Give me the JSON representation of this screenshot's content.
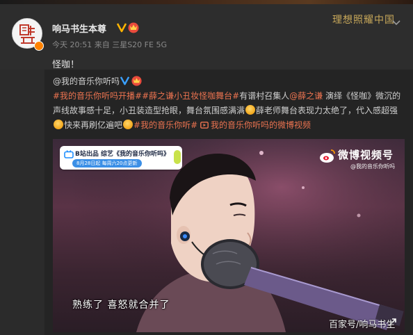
{
  "post": {
    "username": "响马书生本尊",
    "time": "今天 20:51",
    "source_prefix": "来自",
    "source": "三星S20 FE 5G",
    "text": "怪咖！",
    "brand_text": "理想照耀中国"
  },
  "repost": {
    "author": "@我的音乐你听吗",
    "segments": [
      {
        "text": "#我的音乐你听吗开播#",
        "type": "tag"
      },
      {
        "text": "#薛之谦小丑妆怪咖舞台#",
        "type": "tag"
      },
      {
        "text": "有谱村召集人",
        "type": "plain"
      },
      {
        "text": "@薛之谦",
        "type": "mention"
      },
      {
        "text": " 演绎《怪咖》微沉的声线故事感十足，小丑装造型抢眼，舞台氛围感满满",
        "type": "plain"
      },
      {
        "text": "薛老师舞台表现力太绝了，代入感超强",
        "type": "plain"
      },
      {
        "text": "快来再刷亿遍吧",
        "type": "plain"
      },
      {
        "text": "#我的音乐你听#",
        "type": "tag"
      },
      {
        "text": "我的音乐你听吗的微博视频",
        "type": "tag"
      }
    ]
  },
  "video": {
    "program_line1": "B站出品  综艺《我的音乐你听吗》",
    "program_line2": "8月28日起 每周六20点更新",
    "weibo_title": "微博视频号",
    "weibo_sub": "@我的音乐你听吗",
    "subtitle": "熟练了   喜怒就合并了"
  },
  "watermark": "百家号/响马书生",
  "colors": {
    "page_bg": "#2b2b2b",
    "tag": "#eb7350",
    "brand": "#c8a85a",
    "verified": "#ffb400"
  },
  "icons": [
    "verified-v-icon",
    "crown-badge-icon",
    "chevron-down-icon",
    "emoji-icon",
    "video-link-icon",
    "weibo-logo-icon",
    "expand-icon"
  ]
}
